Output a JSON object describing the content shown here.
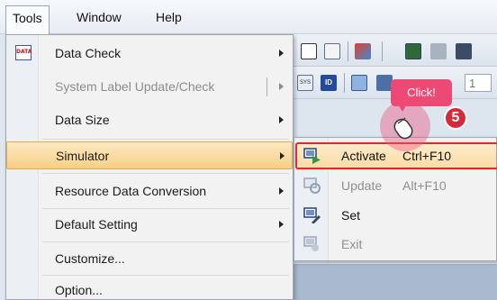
{
  "menubar": {
    "items": [
      {
        "label": "Tools",
        "active": true
      },
      {
        "label": "Window",
        "active": false
      },
      {
        "label": "Help",
        "active": false
      }
    ]
  },
  "tools_menu": {
    "items": [
      {
        "label": "Data Check",
        "has_submenu": true,
        "disabled": false,
        "icon": "data-check-icon"
      },
      {
        "label": "System Label Update/Check",
        "has_submenu": true,
        "disabled": true
      },
      {
        "label": "Data Size",
        "has_submenu": true,
        "disabled": false
      },
      {
        "label": "Simulator",
        "has_submenu": true,
        "disabled": false,
        "highlighted": true
      },
      {
        "label": "Resource Data Conversion",
        "has_submenu": true,
        "disabled": false
      },
      {
        "label": "Default Setting",
        "has_submenu": true,
        "disabled": false
      },
      {
        "label": "Customize...",
        "has_submenu": false,
        "disabled": false
      },
      {
        "label": "Option...",
        "has_submenu": false,
        "disabled": false
      }
    ],
    "data_icon_text": "DATA"
  },
  "simulator_submenu": {
    "items": [
      {
        "label": "Activate",
        "shortcut": "Ctrl+F10",
        "disabled": false,
        "icon": "activate-icon"
      },
      {
        "label": "Update",
        "shortcut": "Alt+F10",
        "disabled": true,
        "icon": "update-icon"
      },
      {
        "label": "Set",
        "shortcut": "",
        "disabled": false,
        "icon": "set-icon"
      },
      {
        "label": "Exit",
        "shortcut": "",
        "disabled": true,
        "icon": "exit-icon"
      }
    ]
  },
  "annotation": {
    "callout_text": "Click!",
    "step_number": "5"
  },
  "toolbar": {
    "sys_icon_text": "SYS",
    "id_icon_text": "ID",
    "field_value": "1"
  },
  "colors": {
    "highlight_fill": "#f9d796",
    "highlight_border": "#e3a94a",
    "callout": "#ec4a74",
    "step_badge": "#d62a3b",
    "annotation_box": "#e0273a"
  }
}
